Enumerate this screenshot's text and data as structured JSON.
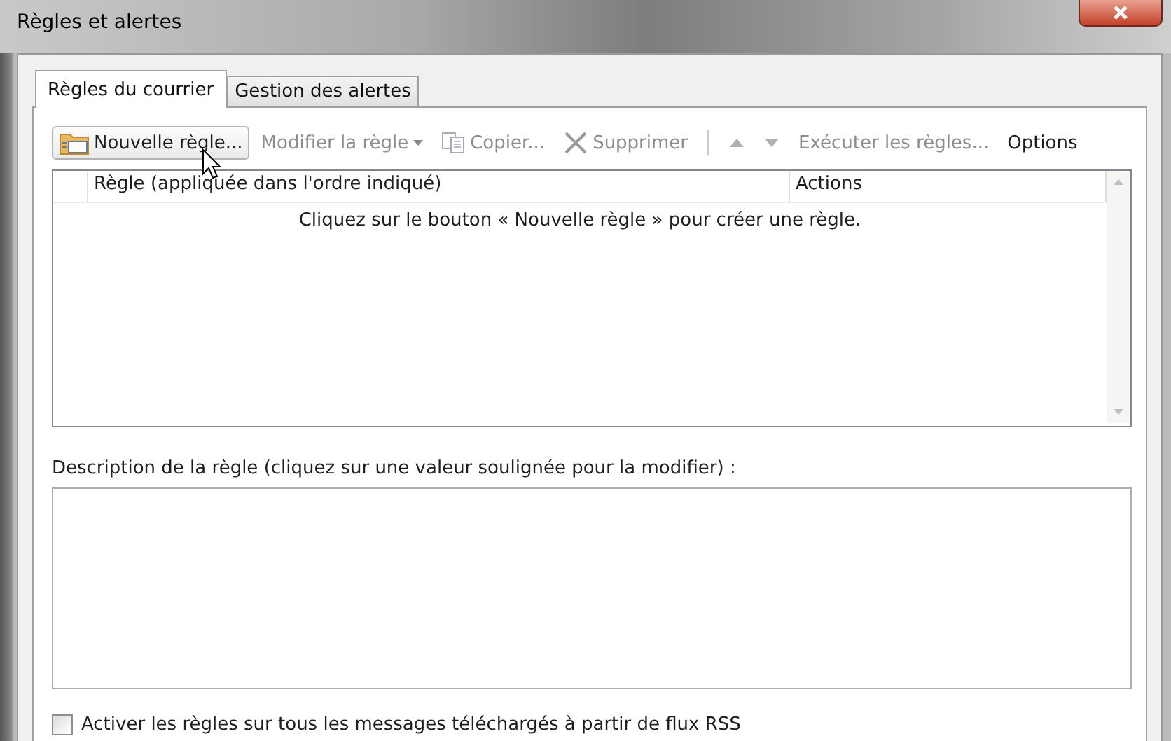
{
  "window": {
    "title": "Règles et alertes"
  },
  "tabs": [
    {
      "label": "Règles du courrier",
      "selected": true
    },
    {
      "label": "Gestion des alertes",
      "selected": false
    }
  ],
  "toolbar": [
    {
      "kind": "button",
      "label": "Nouvelle règle...",
      "disabled": false,
      "hovered": true
    },
    {
      "kind": "dropdown",
      "label": "Modifier la règle",
      "disabled": true,
      "hovered": false
    },
    {
      "kind": "button",
      "label": "Copier...",
      "disabled": true,
      "hovered": false
    },
    {
      "kind": "button",
      "label": "Supprimer",
      "disabled": true,
      "hovered": false
    },
    {
      "kind": "separator"
    },
    {
      "kind": "arrow",
      "disabled": true,
      "hovered": false
    },
    {
      "kind": "arrow",
      "disabled": true,
      "hovered": false
    },
    {
      "kind": "button",
      "label": "Exécuter les règles...",
      "disabled": true,
      "hovered": false
    },
    {
      "kind": "button",
      "label": "Options",
      "disabled": false,
      "hovered": false
    }
  ],
  "table": {
    "columns": [
      "Règle (appliquée dans l'ordre indiqué)",
      "Actions"
    ],
    "empty_message": "Cliquez sur le bouton « Nouvelle règle » pour créer une règle."
  },
  "description": {
    "label": "Description de la règle (cliquez sur une valeur soulignée pour la modifier) :"
  },
  "rss_option": {
    "label": "Activer les règles sur tous les messages téléchargés à partir de flux RSS",
    "checked": false
  }
}
